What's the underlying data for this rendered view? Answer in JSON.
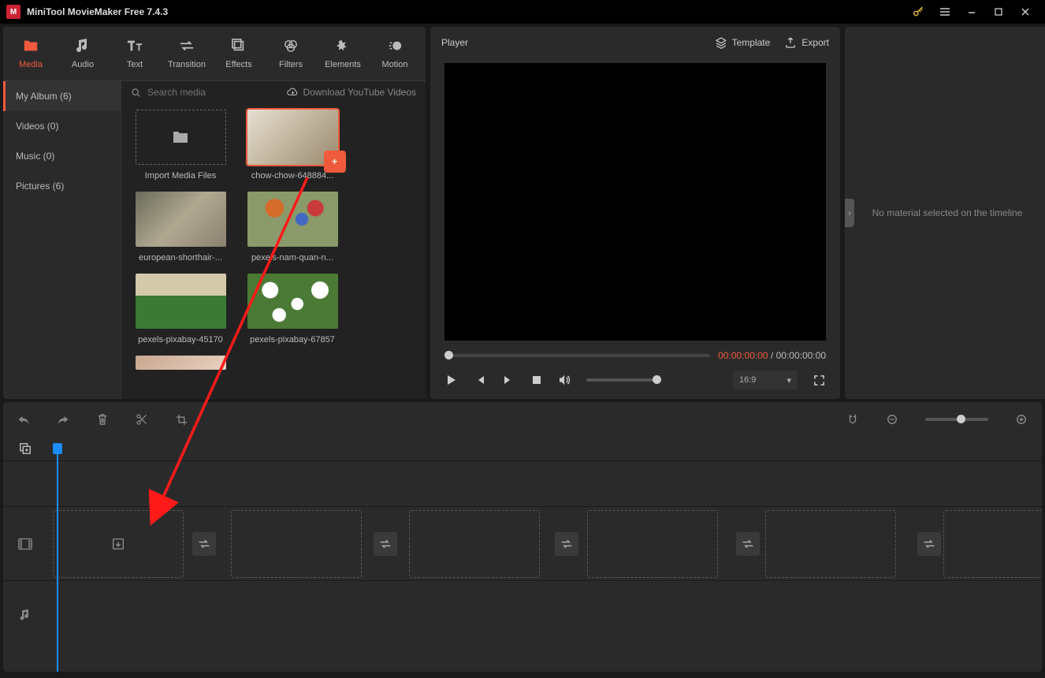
{
  "titlebar": {
    "app_title": "MiniTool MovieMaker Free 7.4.3"
  },
  "toolbar": [
    {
      "label": "Media",
      "icon": "folder",
      "active": true
    },
    {
      "label": "Audio",
      "icon": "music"
    },
    {
      "label": "Text",
      "icon": "text"
    },
    {
      "label": "Transition",
      "icon": "transition"
    },
    {
      "label": "Effects",
      "icon": "effects"
    },
    {
      "label": "Filters",
      "icon": "filters"
    },
    {
      "label": "Elements",
      "icon": "elements"
    },
    {
      "label": "Motion",
      "icon": "motion"
    }
  ],
  "sidebar": [
    {
      "label": "My Album (6)",
      "active": true
    },
    {
      "label": "Videos (0)"
    },
    {
      "label": "Music (0)"
    },
    {
      "label": "Pictures (6)"
    }
  ],
  "search": {
    "placeholder": "Search media",
    "download_label": "Download YouTube Videos"
  },
  "media": {
    "import_label": "Import Media Files",
    "items": [
      {
        "caption": "chow-chow-648884...",
        "cls": "p-dog",
        "selected": true
      },
      {
        "caption": "european-shorthair-...",
        "cls": "p-cat"
      },
      {
        "caption": "pexels-nam-quan-n...",
        "cls": "p-flowers"
      },
      {
        "caption": "pexels-pixabay-45170",
        "cls": "p-kittens"
      },
      {
        "caption": "pexels-pixabay-67857",
        "cls": "p-daisy"
      }
    ]
  },
  "player": {
    "title": "Player",
    "template": "Template",
    "export": "Export",
    "current": "00:00:00:00",
    "total": "00:00:00:00",
    "separator": " / ",
    "aspect": "16:9"
  },
  "properties": {
    "empty_text": "No material selected on the timeline"
  }
}
